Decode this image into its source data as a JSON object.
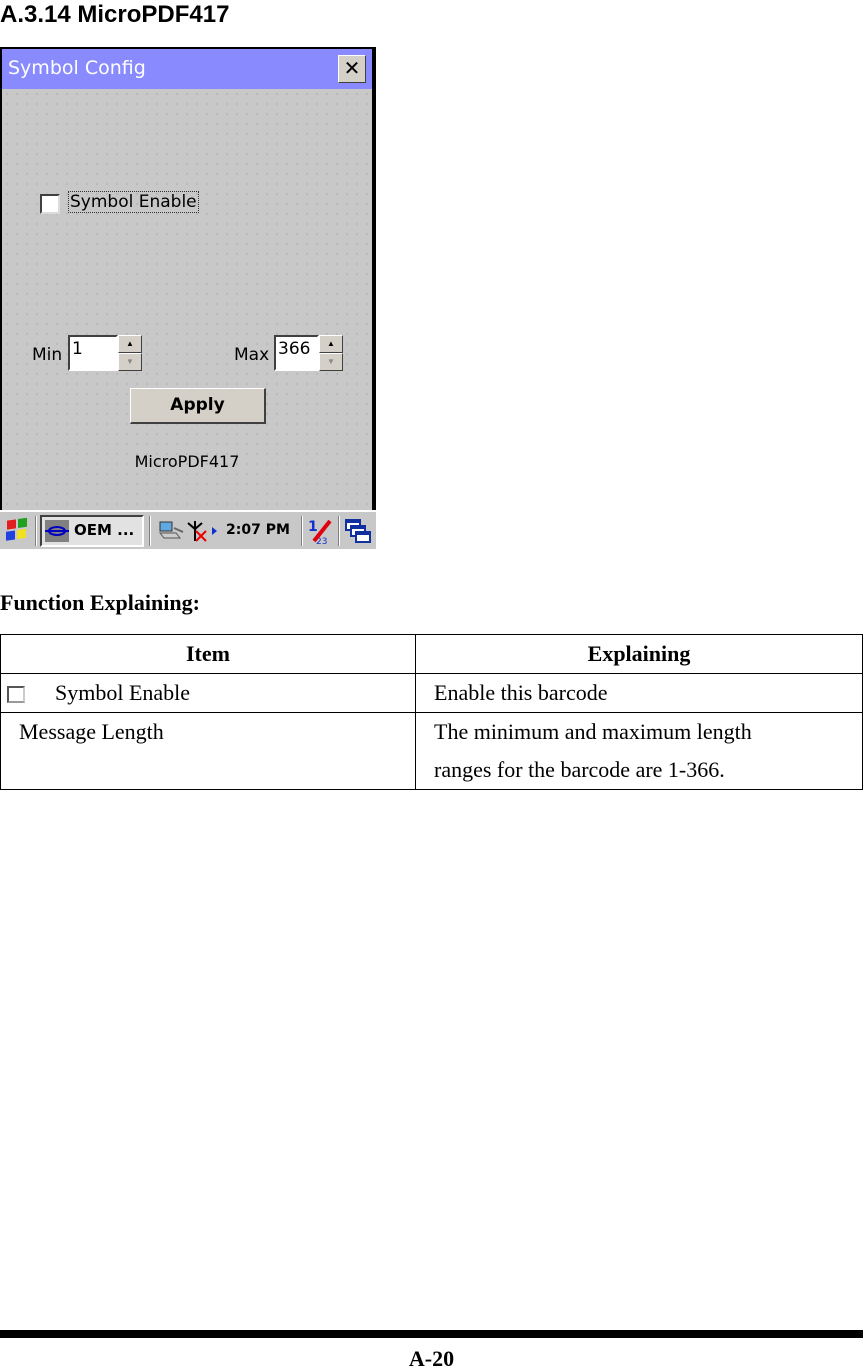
{
  "section_title": "A.3.14 MicroPDF417",
  "device": {
    "window_title": "Symbol Config",
    "close_label": "✕",
    "symbol_enable_label": "Symbol Enable",
    "symbol_enable_checked": false,
    "min_label": "Min",
    "min_value": "1",
    "max_label": "Max",
    "max_value": "366",
    "apply_label": "Apply",
    "symbology_name": "MicroPDF417",
    "taskbar": {
      "task_label": "OEM ...",
      "clock": "2:07 PM",
      "icons": [
        "start-icon",
        "network-icon",
        "signal-off-icon",
        "input-panel-icon",
        "switch-windows-icon"
      ]
    }
  },
  "function_title": "Function Explaining:",
  "table": {
    "headers": [
      "Item",
      "Explaining"
    ],
    "rows": [
      {
        "item": "Symbol Enable",
        "explain": "Enable this barcode",
        "has_checkbox": true
      },
      {
        "item": "Message Length",
        "explain_line1": "The minimum and maximum length",
        "explain_line2": "ranges for the barcode are 1-366."
      }
    ]
  },
  "page_number": "A-20"
}
